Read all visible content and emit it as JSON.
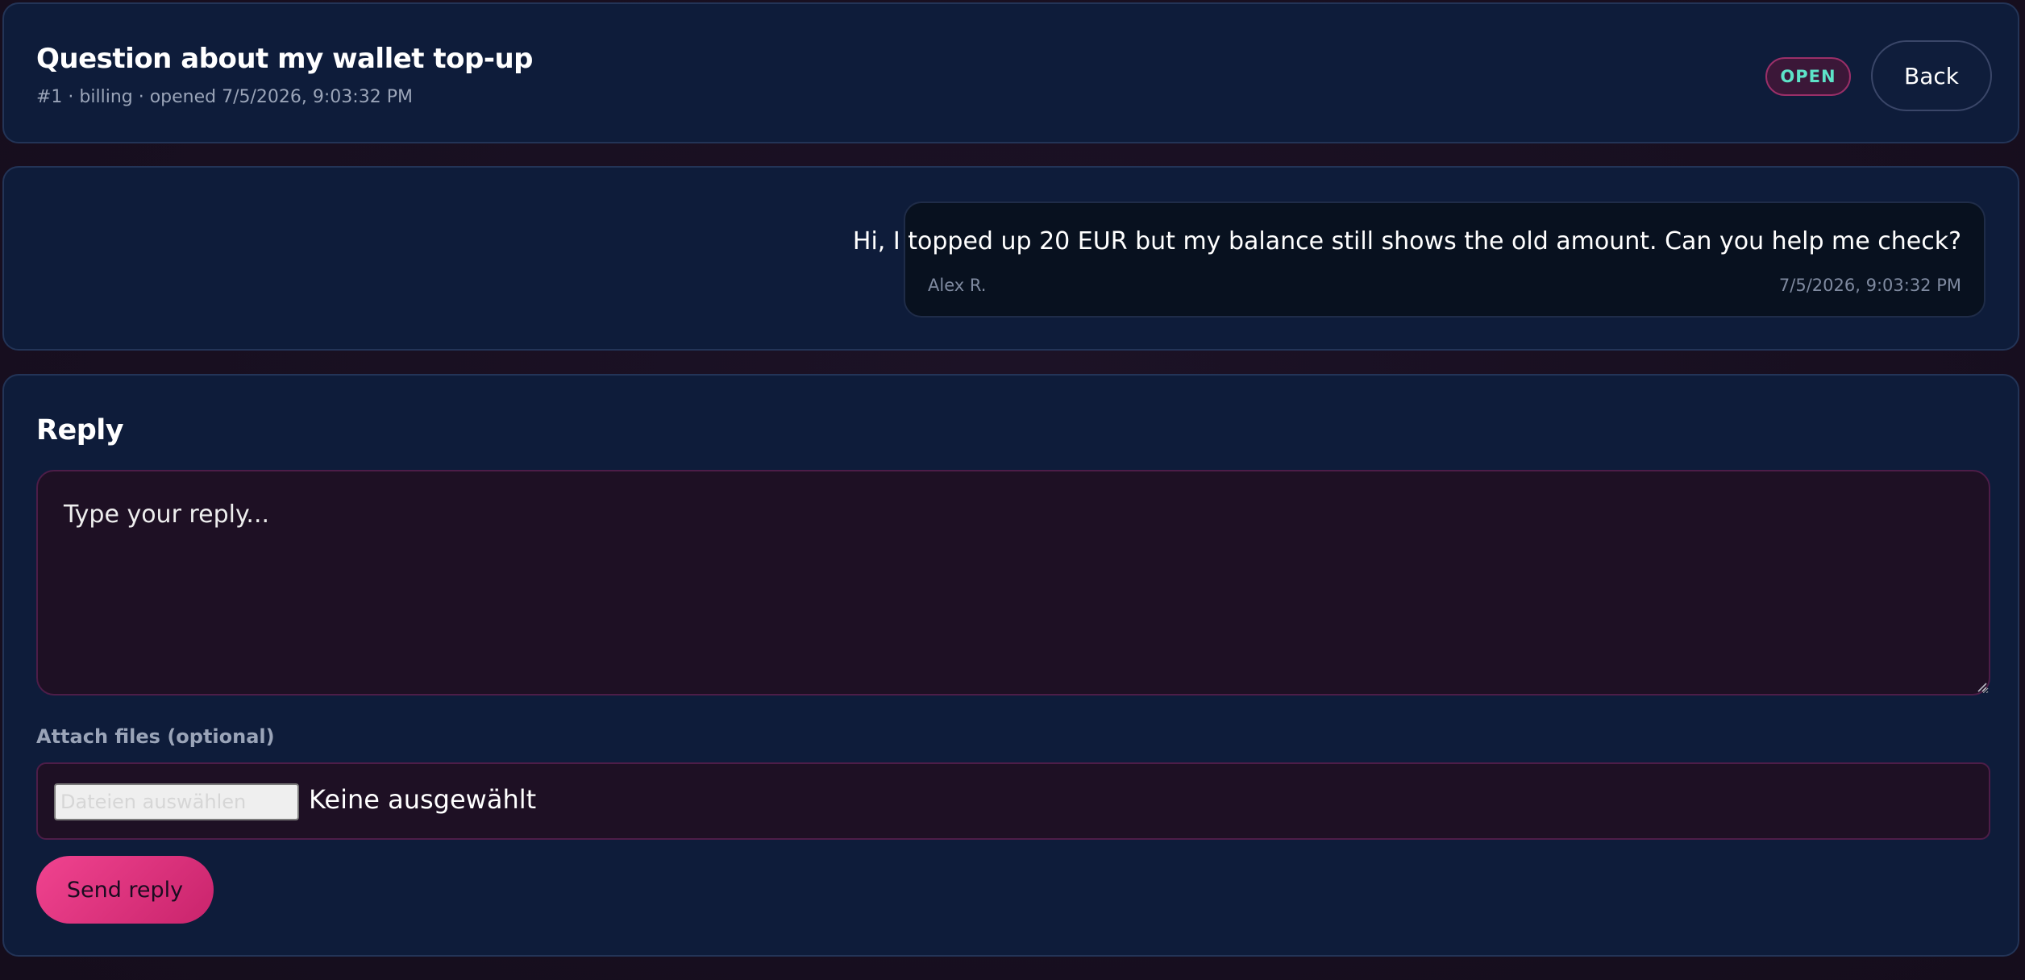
{
  "ticket": {
    "title": "Question about my wallet top-up",
    "meta": "#1 · billing · opened 7/5/2026, 9:03:32 PM",
    "status": "OPEN",
    "back_label": "Back"
  },
  "messages": [
    {
      "text": "Hi, I topped up 20 EUR but my balance still shows the old amount. Can you help me check?",
      "author": "Alex R.",
      "time": "7/5/2026, 9:03:32 PM"
    }
  ],
  "reply": {
    "heading": "Reply",
    "placeholder": "Type your reply...",
    "value": "",
    "attach_label": "Attach files (optional)",
    "file_button_label": "Dateien auswählen",
    "file_status": "Keine ausgewählt",
    "send_label": "Send reply"
  },
  "colors": {
    "background": "#170f20",
    "panel": "#0e1c3a",
    "accent": "#e23a84",
    "status_text": "#5de3c8",
    "status_bg": "#3b1738"
  }
}
